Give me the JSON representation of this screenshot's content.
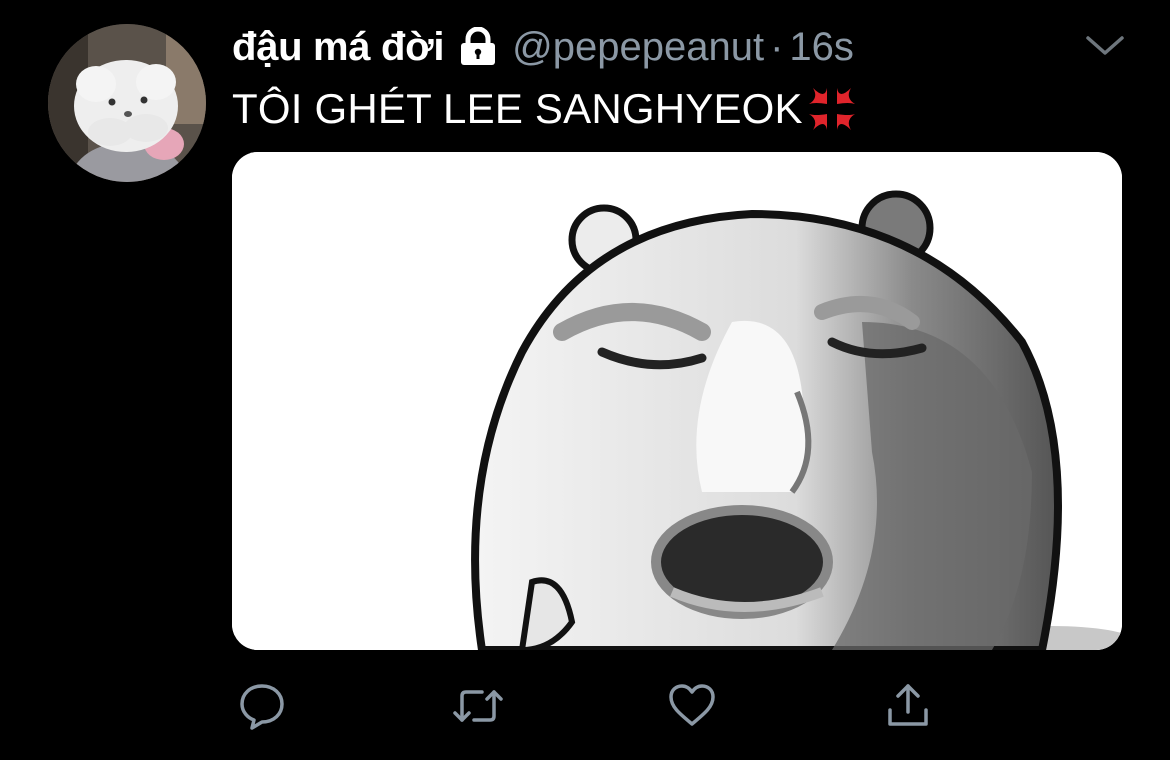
{
  "tweet": {
    "display_name": "đậu má đời",
    "handle": "@pepepeanut",
    "separator": "·",
    "timestamp": "16s",
    "text": "TÔI GHÉT LEE SANGHYEOK",
    "text_emoji": "anger-symbol-icon",
    "protected": true
  },
  "avatar": {
    "icon": "profile-photo"
  },
  "media": {
    "icon": "bear-meme-image"
  },
  "actions": [
    {
      "name": "reply",
      "icon": "reply-icon"
    },
    {
      "name": "retweet",
      "icon": "retweet-icon"
    },
    {
      "name": "like",
      "icon": "heart-icon"
    },
    {
      "name": "share",
      "icon": "share-icon"
    }
  ],
  "colors": {
    "background": "#000000",
    "primary_text": "#ffffff",
    "secondary_text": "#8b98a5",
    "anger_red": "#e0242b"
  }
}
